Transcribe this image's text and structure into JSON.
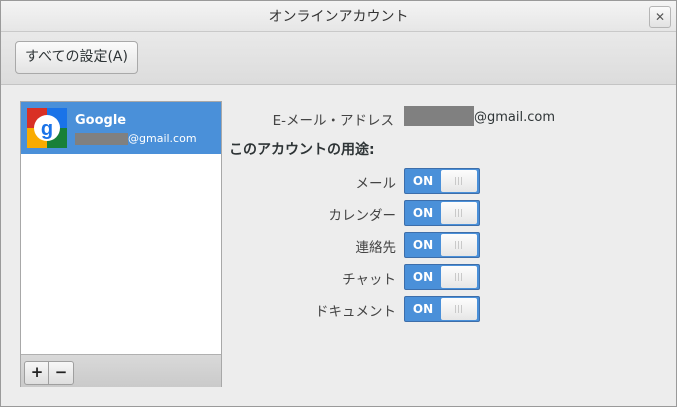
{
  "window": {
    "title": "オンラインアカウント",
    "close_glyph": "✕"
  },
  "toolbar": {
    "all_settings_label": "すべての設定(A)"
  },
  "accounts": [
    {
      "name": "Google",
      "email_suffix": "@gmail.com",
      "icon": "google-icon"
    }
  ],
  "account_list_footer": {
    "add_label": "+",
    "remove_label": "−"
  },
  "detail": {
    "email_label": "E-メール・アドレス",
    "email_suffix": "@gmail.com",
    "usage_heading": "このアカウントの用途:",
    "usages": [
      {
        "label": "メール",
        "state": "ON"
      },
      {
        "label": "カレンダー",
        "state": "ON"
      },
      {
        "label": "連絡先",
        "state": "ON"
      },
      {
        "label": "チャット",
        "state": "ON"
      },
      {
        "label": "ドキュメント",
        "state": "ON"
      }
    ]
  },
  "colors": {
    "accent": "#4a90d9",
    "window_bg": "#ededed"
  }
}
